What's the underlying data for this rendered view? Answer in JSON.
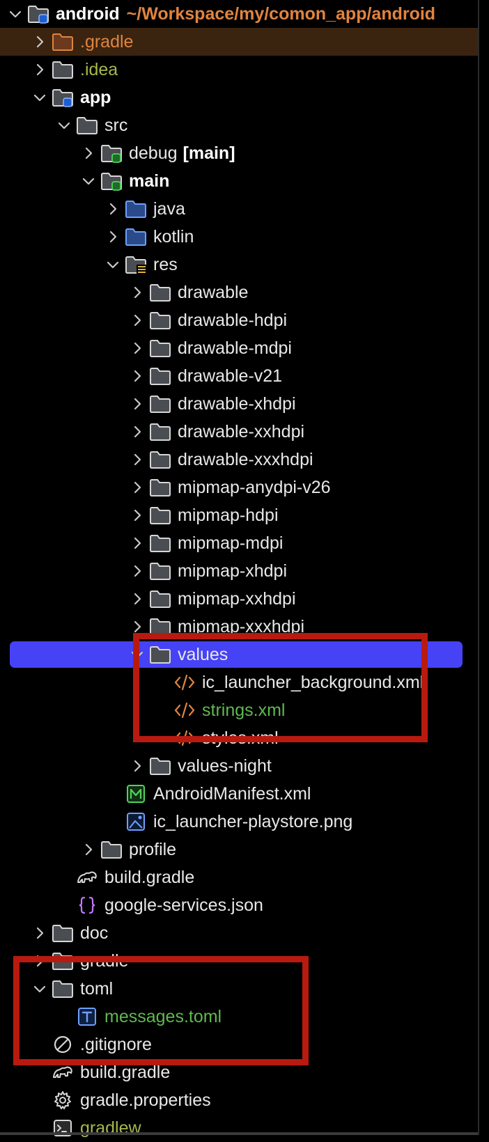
{
  "project_panel": {
    "root": {
      "name": "android",
      "path": "~/Workspace/my/comon_app/android"
    },
    "items": [
      {
        "label": "android",
        "suffix": "~/Workspace/my/comon_app/android",
        "depth": 0,
        "chevron": "down",
        "icon": "module-folder-icon",
        "color": "bold",
        "suffix_style": "path",
        "selected": false
      },
      {
        "label": ".gradle",
        "depth": 1,
        "chevron": "right",
        "icon": "excluded-folder-icon",
        "color": "orange",
        "highlight": "project"
      },
      {
        "label": ".idea",
        "depth": 1,
        "chevron": "right",
        "icon": "folder-icon",
        "color": "olive"
      },
      {
        "label": "app",
        "depth": 1,
        "chevron": "down",
        "icon": "module-folder-icon",
        "color": "bold"
      },
      {
        "label": "src",
        "depth": 2,
        "chevron": "down",
        "icon": "folder-icon"
      },
      {
        "label": "debug",
        "suffix": "[main]",
        "depth": 3,
        "chevron": "right",
        "icon": "source-set-folder-icon",
        "suffix_style": "bold"
      },
      {
        "label": "main",
        "depth": 3,
        "chevron": "down",
        "icon": "source-set-folder-icon",
        "color": "bold"
      },
      {
        "label": "java",
        "depth": 4,
        "chevron": "right",
        "icon": "source-folder-icon"
      },
      {
        "label": "kotlin",
        "depth": 4,
        "chevron": "right",
        "icon": "source-folder-icon"
      },
      {
        "label": "res",
        "depth": 4,
        "chevron": "down",
        "icon": "resource-folder-icon"
      },
      {
        "label": "drawable",
        "depth": 5,
        "chevron": "right",
        "icon": "folder-icon"
      },
      {
        "label": "drawable-hdpi",
        "depth": 5,
        "chevron": "right",
        "icon": "folder-icon"
      },
      {
        "label": "drawable-mdpi",
        "depth": 5,
        "chevron": "right",
        "icon": "folder-icon"
      },
      {
        "label": "drawable-v21",
        "depth": 5,
        "chevron": "right",
        "icon": "folder-icon"
      },
      {
        "label": "drawable-xhdpi",
        "depth": 5,
        "chevron": "right",
        "icon": "folder-icon"
      },
      {
        "label": "drawable-xxhdpi",
        "depth": 5,
        "chevron": "right",
        "icon": "folder-icon"
      },
      {
        "label": "drawable-xxxhdpi",
        "depth": 5,
        "chevron": "right",
        "icon": "folder-icon"
      },
      {
        "label": "mipmap-anydpi-v26",
        "depth": 5,
        "chevron": "right",
        "icon": "folder-icon"
      },
      {
        "label": "mipmap-hdpi",
        "depth": 5,
        "chevron": "right",
        "icon": "folder-icon"
      },
      {
        "label": "mipmap-mdpi",
        "depth": 5,
        "chevron": "right",
        "icon": "folder-icon"
      },
      {
        "label": "mipmap-xhdpi",
        "depth": 5,
        "chevron": "right",
        "icon": "folder-icon"
      },
      {
        "label": "mipmap-xxhdpi",
        "depth": 5,
        "chevron": "right",
        "icon": "folder-icon"
      },
      {
        "label": "mipmap-xxxhdpi",
        "depth": 5,
        "chevron": "right",
        "icon": "folder-icon"
      },
      {
        "label": "values",
        "depth": 5,
        "chevron": "down",
        "icon": "folder-icon",
        "selected": true
      },
      {
        "label": "ic_launcher_background.xml",
        "depth": 6,
        "chevron": "none",
        "icon": "xml-file-icon"
      },
      {
        "label": "strings.xml",
        "depth": 6,
        "chevron": "none",
        "icon": "xml-file-icon",
        "color": "green"
      },
      {
        "label": "styles.xml",
        "depth": 6,
        "chevron": "none",
        "icon": "xml-file-icon"
      },
      {
        "label": "values-night",
        "depth": 5,
        "chevron": "right",
        "icon": "folder-icon"
      },
      {
        "label": "AndroidManifest.xml",
        "depth": 4,
        "chevron": "none",
        "icon": "manifest-file-icon"
      },
      {
        "label": "ic_launcher-playstore.png",
        "depth": 4,
        "chevron": "none",
        "icon": "image-file-icon"
      },
      {
        "label": "profile",
        "depth": 3,
        "chevron": "right",
        "icon": "folder-icon"
      },
      {
        "label": "build.gradle",
        "depth": 2,
        "chevron": "none",
        "icon": "gradle-file-icon"
      },
      {
        "label": "google-services.json",
        "depth": 2,
        "chevron": "none",
        "icon": "json-file-icon"
      },
      {
        "label": "doc",
        "depth": 1,
        "chevron": "right",
        "icon": "folder-icon"
      },
      {
        "label": "gradle",
        "depth": 1,
        "chevron": "right",
        "icon": "folder-icon"
      },
      {
        "label": "toml",
        "depth": 1,
        "chevron": "down",
        "icon": "folder-icon"
      },
      {
        "label": "messages.toml",
        "depth": 2,
        "chevron": "none",
        "icon": "toml-file-icon",
        "color": "green"
      },
      {
        "label": ".gitignore",
        "depth": 1,
        "chevron": "none",
        "icon": "ignore-file-icon"
      },
      {
        "label": "build.gradle",
        "depth": 1,
        "chevron": "none",
        "icon": "gradle-file-icon"
      },
      {
        "label": "gradle.properties",
        "depth": 1,
        "chevron": "none",
        "icon": "gear-file-icon"
      },
      {
        "label": "gradlew",
        "depth": 1,
        "chevron": "none",
        "icon": "shell-file-icon",
        "color": "olive"
      }
    ]
  },
  "colors": {
    "background": "#000000",
    "selection": "#4642f5",
    "highlight_box": "#b81a0f",
    "excluded_row": "#3a2410",
    "path_text": "#e0843f",
    "vcs_added": "#5fb84f",
    "ignored_text": "#a6b84b"
  }
}
